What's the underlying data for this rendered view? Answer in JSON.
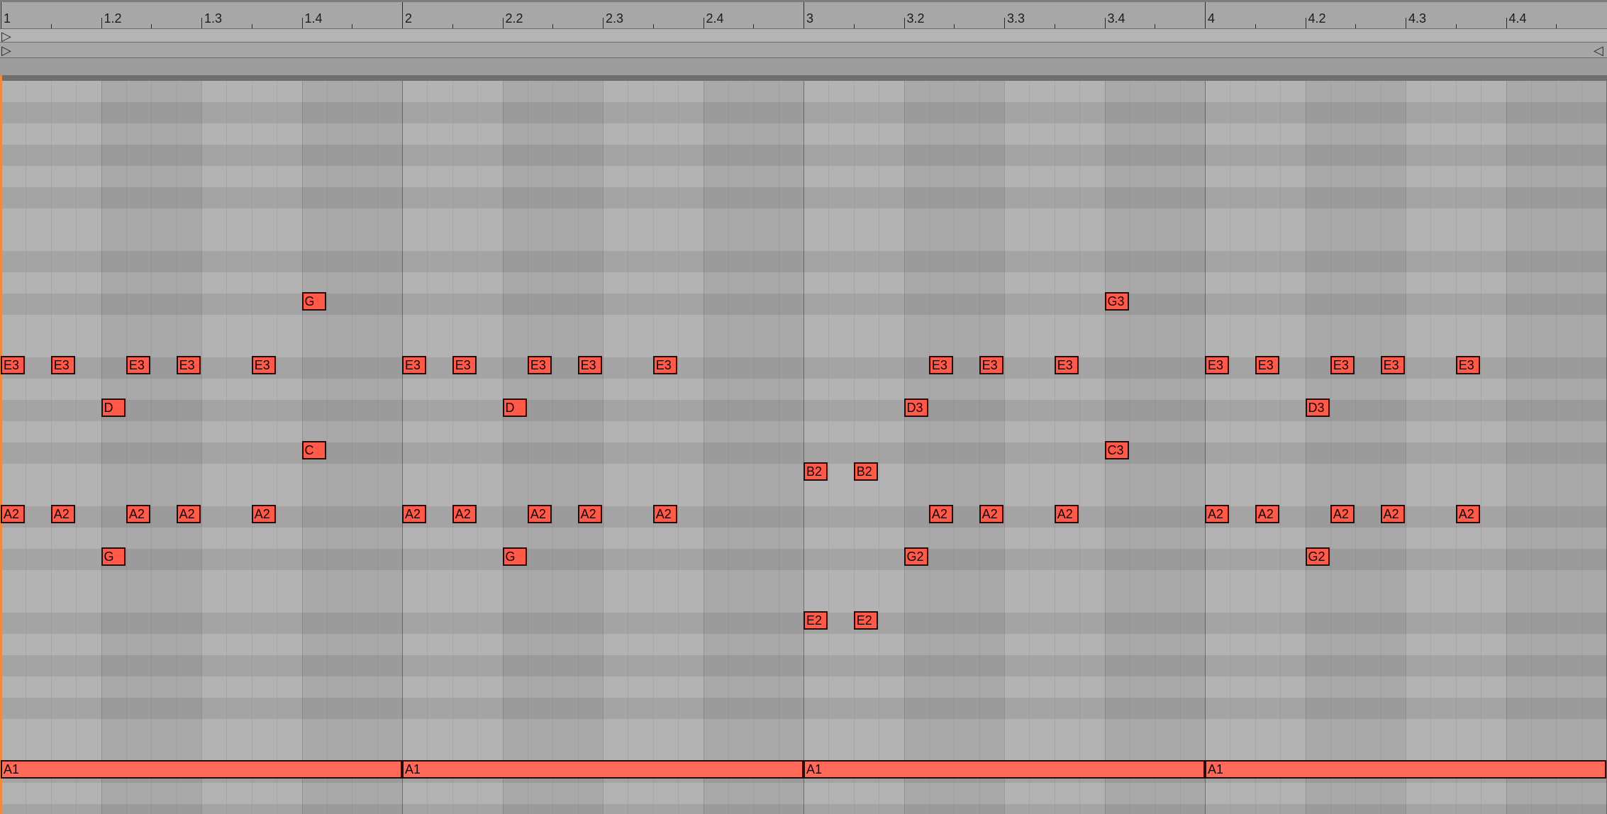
{
  "ruler": {
    "labels": [
      "1",
      "1.2",
      "1.3",
      "1.4",
      "2",
      "2.2",
      "2.3",
      "2.4",
      "3",
      "3.2",
      "3.3",
      "3.4",
      "4",
      "4.2",
      "4.3",
      "4.4"
    ]
  },
  "colors": {
    "note": "#ff5a4a",
    "playhead": "#f08a3c",
    "note_border": "#2a0b07"
  },
  "icons": {
    "loop_start": "play-triangle-right-icon",
    "loop_end": "play-triangle-left-icon"
  },
  "note_grid": {
    "lane_labels": [
      "A1"
    ],
    "notes": [
      {
        "label": "G",
        "row": 10,
        "beat": 1.75
      },
      {
        "label": "G3",
        "row": 10,
        "beat": 3.75
      },
      {
        "label": "E3",
        "row": 13,
        "beat": 1.0
      },
      {
        "label": "E3",
        "row": 13,
        "beat": 1.125
      },
      {
        "label": "E3",
        "row": 13,
        "beat": 1.3125
      },
      {
        "label": "E3",
        "row": 13,
        "beat": 1.4375
      },
      {
        "label": "E3",
        "row": 13,
        "beat": 1.625
      },
      {
        "label": "E3",
        "row": 13,
        "beat": 2.0
      },
      {
        "label": "E3",
        "row": 13,
        "beat": 2.125
      },
      {
        "label": "E3",
        "row": 13,
        "beat": 2.3125
      },
      {
        "label": "E3",
        "row": 13,
        "beat": 2.4375
      },
      {
        "label": "E3",
        "row": 13,
        "beat": 2.625
      },
      {
        "label": "E3",
        "row": 13,
        "beat": 3.3125
      },
      {
        "label": "E3",
        "row": 13,
        "beat": 3.4375
      },
      {
        "label": "E3",
        "row": 13,
        "beat": 3.625
      },
      {
        "label": "E3",
        "row": 13,
        "beat": 4.0
      },
      {
        "label": "E3",
        "row": 13,
        "beat": 4.125
      },
      {
        "label": "E3",
        "row": 13,
        "beat": 4.3125
      },
      {
        "label": "E3",
        "row": 13,
        "beat": 4.4375
      },
      {
        "label": "E3",
        "row": 13,
        "beat": 4.625
      },
      {
        "label": "D",
        "row": 15,
        "beat": 1.25
      },
      {
        "label": "D",
        "row": 15,
        "beat": 2.25
      },
      {
        "label": "D3",
        "row": 15,
        "beat": 3.25
      },
      {
        "label": "D3",
        "row": 15,
        "beat": 4.25
      },
      {
        "label": "C",
        "row": 17,
        "beat": 1.75
      },
      {
        "label": "C3",
        "row": 17,
        "beat": 3.75
      },
      {
        "label": "B2",
        "row": 18,
        "beat": 3.0
      },
      {
        "label": "B2",
        "row": 18,
        "beat": 3.125
      },
      {
        "label": "A2",
        "row": 20,
        "beat": 1.0
      },
      {
        "label": "A2",
        "row": 20,
        "beat": 1.125
      },
      {
        "label": "A2",
        "row": 20,
        "beat": 1.3125
      },
      {
        "label": "A2",
        "row": 20,
        "beat": 1.4375
      },
      {
        "label": "A2",
        "row": 20,
        "beat": 1.625
      },
      {
        "label": "A2",
        "row": 20,
        "beat": 2.0
      },
      {
        "label": "A2",
        "row": 20,
        "beat": 2.125
      },
      {
        "label": "A2",
        "row": 20,
        "beat": 2.3125
      },
      {
        "label": "A2",
        "row": 20,
        "beat": 2.4375
      },
      {
        "label": "A2",
        "row": 20,
        "beat": 2.625
      },
      {
        "label": "A2",
        "row": 20,
        "beat": 3.3125
      },
      {
        "label": "A2",
        "row": 20,
        "beat": 3.4375
      },
      {
        "label": "A2",
        "row": 20,
        "beat": 3.625
      },
      {
        "label": "A2",
        "row": 20,
        "beat": 4.0
      },
      {
        "label": "A2",
        "row": 20,
        "beat": 4.125
      },
      {
        "label": "A2",
        "row": 20,
        "beat": 4.3125
      },
      {
        "label": "A2",
        "row": 20,
        "beat": 4.4375
      },
      {
        "label": "A2",
        "row": 20,
        "beat": 4.625
      },
      {
        "label": "G",
        "row": 22,
        "beat": 1.25
      },
      {
        "label": "G",
        "row": 22,
        "beat": 2.25
      },
      {
        "label": "G2",
        "row": 22,
        "beat": 3.25
      },
      {
        "label": "G2",
        "row": 22,
        "beat": 4.25
      },
      {
        "label": "E2",
        "row": 25,
        "beat": 3.0
      },
      {
        "label": "E2",
        "row": 25,
        "beat": 3.125
      },
      {
        "label": "A1",
        "row": 32,
        "beat": 1.0,
        "length": 1.0
      },
      {
        "label": "A1",
        "row": 32,
        "beat": 2.0,
        "length": 1.0
      },
      {
        "label": "A1",
        "row": 32,
        "beat": 3.0,
        "length": 1.0
      },
      {
        "label": "A1",
        "row": 32,
        "beat": 4.0,
        "length": 1.0
      }
    ]
  }
}
